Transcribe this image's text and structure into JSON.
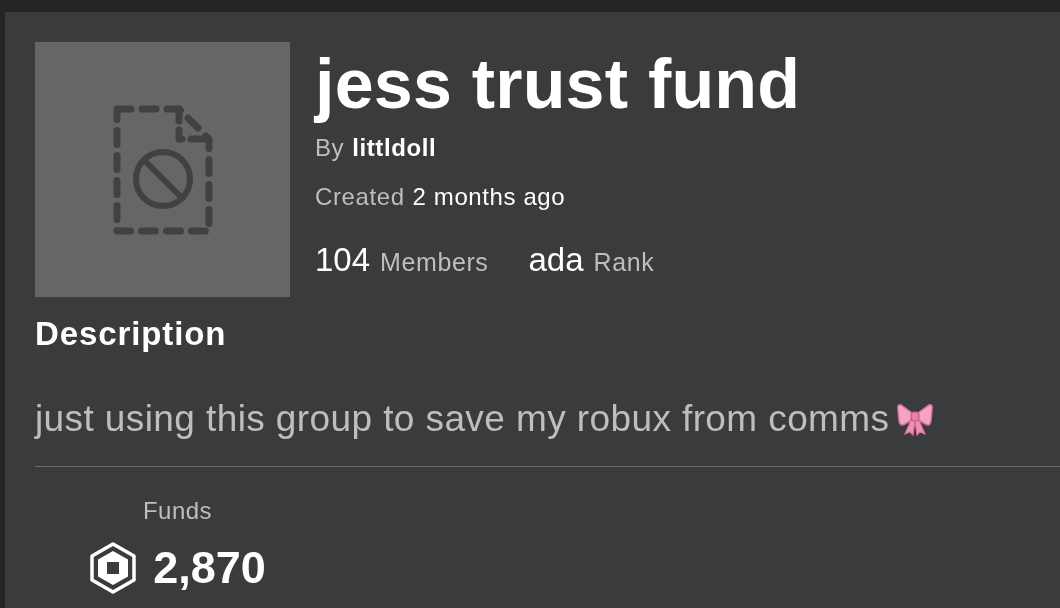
{
  "group": {
    "title": "jess trust fund",
    "owner_label": "By",
    "owner": "littldoll",
    "created_label": "Created",
    "created": "2 months ago",
    "stats": [
      {
        "value": "104",
        "caption": "Members"
      },
      {
        "value": "ada",
        "caption": "Rank"
      }
    ]
  },
  "description": {
    "heading": "Description",
    "text": "just using this group to save my robux from comms"
  },
  "funds": {
    "label": "Funds",
    "amount": "2,870"
  }
}
